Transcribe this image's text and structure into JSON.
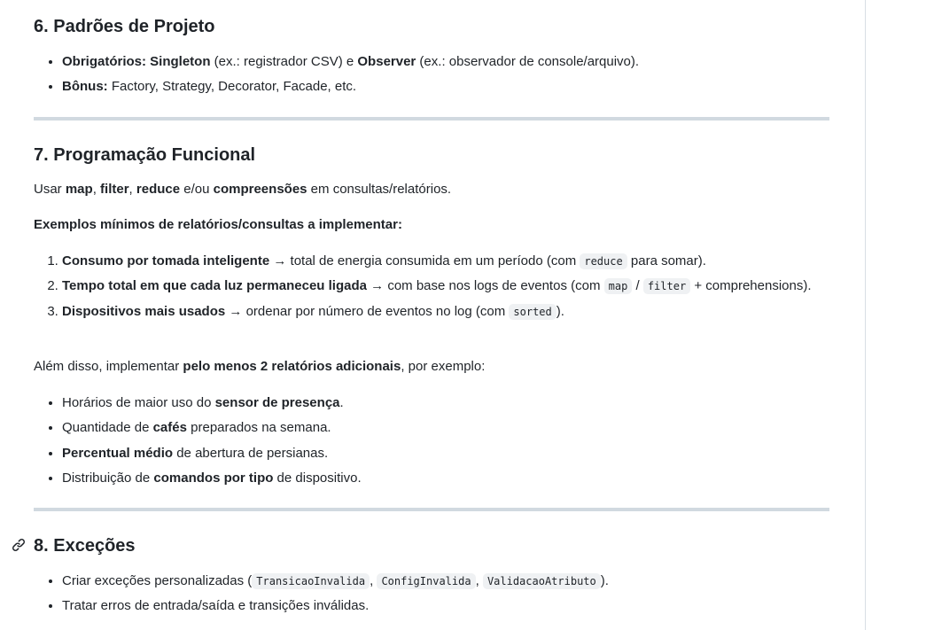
{
  "s6": {
    "title": "6. Padrões de Projeto",
    "b1_k1": "Obrigatórios: Singleton",
    "b1_t1": " (ex.: registrador CSV) e ",
    "b1_k2": "Observer",
    "b1_t2": " (ex.: observador de console/arquivo).",
    "b2_k": "Bônus:",
    "b2_t": " Factory, Strategy, Decorator, Facade, etc."
  },
  "s7": {
    "title": "7. Programação Funcional",
    "p1": [
      "Usar ",
      "map",
      ", ",
      "filter",
      ", ",
      "reduce",
      " e/ou ",
      "compreensões",
      " em consultas/relatórios."
    ],
    "p2": "Exemplos mínimos de relatórios/consultas a implementar:",
    "o1": [
      "Consumo por tomada inteligente",
      " → total de energia consumida em um período (com ",
      "reduce",
      " para somar)."
    ],
    "o2": [
      "Tempo total em que cada luz permaneceu ligada",
      " → com base nos logs de eventos (com ",
      "map",
      " / ",
      "filter",
      " + comprehensions)."
    ],
    "o3": [
      "Dispositivos mais usados",
      " → ordenar por número de eventos no log (com ",
      "sorted",
      ")."
    ],
    "p3": [
      "Além disso, implementar ",
      "pelo menos 2 relatórios adicionais",
      ", por exemplo:"
    ],
    "u1": [
      "Horários de maior uso do ",
      "sensor de presença",
      "."
    ],
    "u2": [
      "Quantidade de ",
      "cafés",
      " preparados na semana."
    ],
    "u3": [
      "Percentual médio",
      " de abertura de persianas."
    ],
    "u4": [
      "Distribuição de ",
      "comandos por tipo",
      " de dispositivo."
    ]
  },
  "s8": {
    "title": "8. Exceções",
    "b1": [
      "Criar exceções personalizadas (",
      "TransicaoInvalida",
      ", ",
      "ConfigInvalida",
      ", ",
      "ValidacaoAtributo",
      ")."
    ],
    "b2": "Tratar erros de entrada/saída e transições inválidas."
  },
  "icons": {
    "anchor": "link-icon"
  }
}
